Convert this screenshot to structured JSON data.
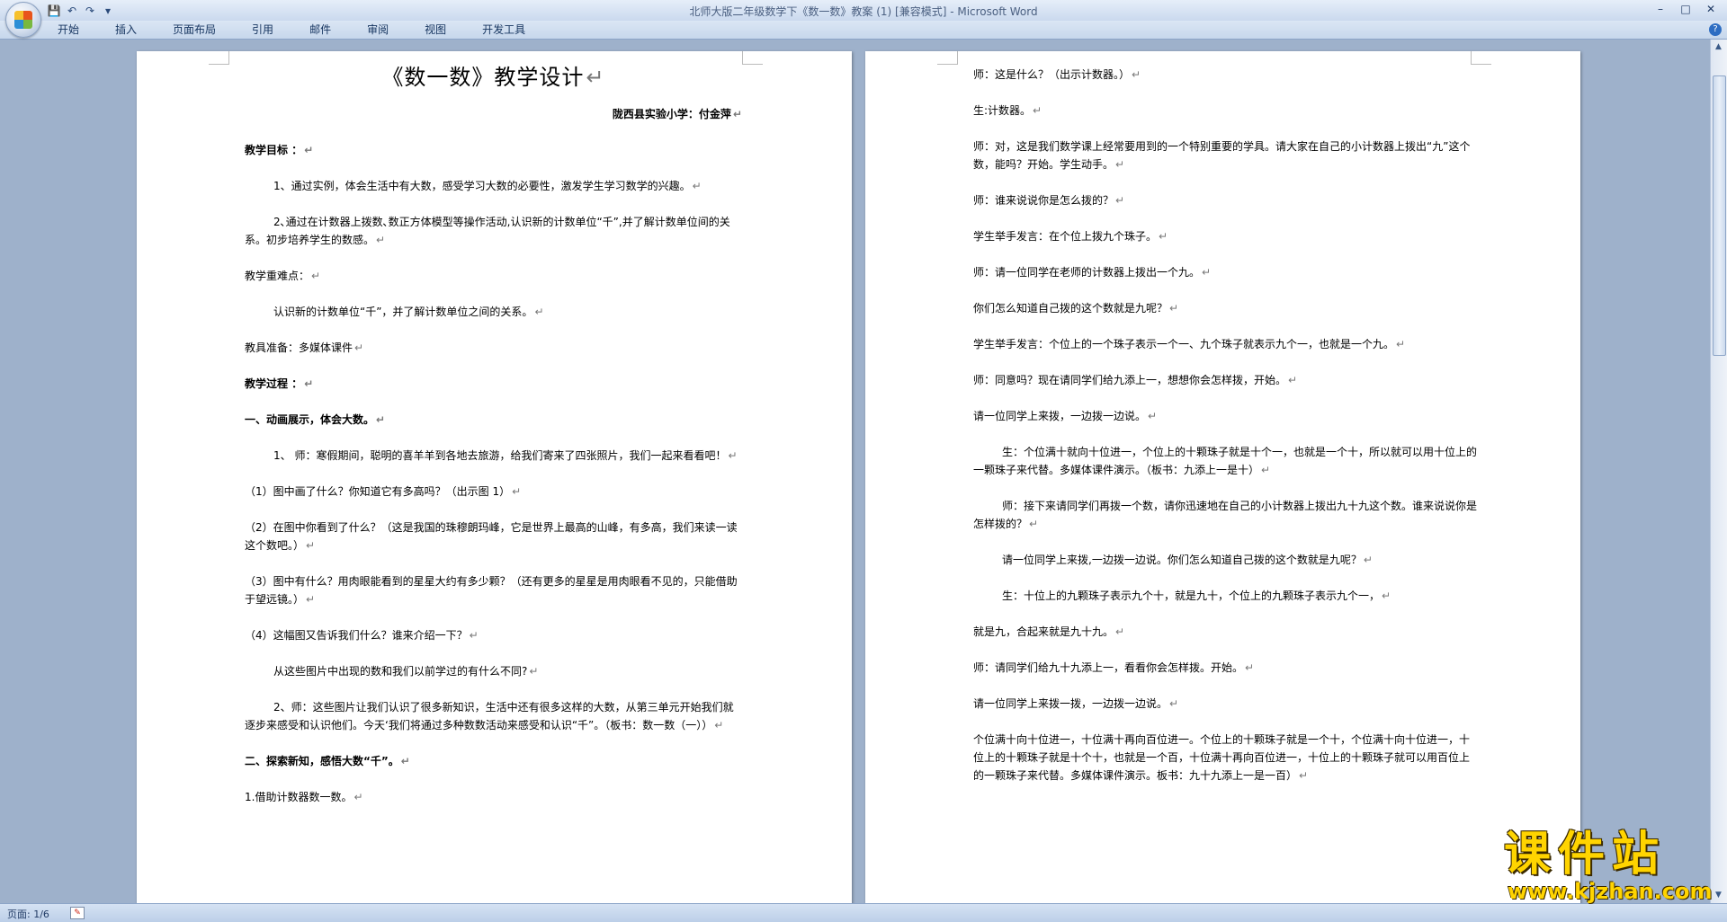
{
  "window": {
    "title": "北师大版二年级数学下《数一数》教案 (1) [兼容模式] - Microsoft Word",
    "min": "–",
    "max": "□",
    "close": "✕"
  },
  "quick_access": {
    "save_icon": "save-icon",
    "undo": "↶",
    "redo": "↷",
    "customize": "▾"
  },
  "ribbon": {
    "tabs": [
      "开始",
      "插入",
      "页面布局",
      "引用",
      "邮件",
      "审阅",
      "视图",
      "开发工具"
    ],
    "help": "?"
  },
  "left_page": {
    "title": "《数一数》教学设计",
    "author": "陇西县实验小学：付金萍",
    "paragraphs": [
      "教学目标 ：",
      "1、通过实例，体会生活中有大数，感受学习大数的必要性，激发学生学习数学的兴趣。",
      "2､通过在计数器上拨数､数正方体模型等操作活动,认识新的计数单位“千”,并了解计数单位间的关系。初步培养学生的数感。",
      "教学重难点：",
      "认识新的计数单位“千”，并了解计数单位之间的关系。",
      "教具准备：多媒体课件",
      "教学过程 ：",
      "一、动画展示，体会大数。",
      "1、 师：寒假期间，聪明的喜羊羊到各地去旅游，给我们寄来了四张照片，我们一起来看看吧！",
      "（1）图中画了什么？你知道它有多高吗？（出示图 1）",
      "（2）在图中你看到了什么？（这是我国的珠穆朗玛峰，它是世界上最高的山峰，有多高，我们来读一读这个数吧。）",
      "（3）图中有什么？用肉眼能看到的星星大约有多少颗？（还有更多的星星是用肉眼看不见的，只能借助于望远镜。）",
      "（4）这幅图又告诉我们什么？谁来介绍一下？",
      "从这些图片中出现的数和我们以前学过的有什么不同?",
      "2、师：这些图片让我们认识了很多新知识，生活中还有很多这样的大数，从第三单元开始我们就逐步来感受和认识他们。今天‘我们将通过多种数数活动来感受和认识“千”。（板书：数一数（一））",
      "二、探索新知，感悟大数“千”。",
      "1.借助计数器数一数。"
    ]
  },
  "right_page": {
    "paragraphs": [
      "师：这是什么？（出示计数器。）",
      "生:计数器。",
      "师：对，这是我们数学课上经常要用到的一个特别重要的学具。请大家在自己的小计数器上拨出“九”这个数，能吗？开始。学生动手。",
      "师：谁来说说你是怎么拨的？",
      "学生举手发言：在个位上拨九个珠子。",
      "师：请一位同学在老师的计数器上拨出一个九。",
      "你们怎么知道自己拨的这个数就是九呢？",
      "学生举手发言：个位上的一个珠子表示一个一、九个珠子就表示九个一，也就是一个九。",
      "师：同意吗？现在请同学们给九添上一，想想你会怎样拨，开始。",
      "请一位同学上来拨，一边拨一边说。",
      "生：个位满十就向十位进一，个位上的十颗珠子就是十个一，也就是一个十，所以就可以用十位上的一颗珠子来代替。多媒体课件演示。（板书：九添上一是十）",
      "师：接下来请同学们再拨一个数，请你迅速地在自己的小计数器上拨出九十九这个数。谁来说说你是怎样拨的？",
      "请一位同学上来拨,一边拨一边说。你们怎么知道自己拨的这个数就是九呢？",
      "生：十位上的九颗珠子表示九个十，就是九十，个位上的九颗珠子表示九个一，",
      "就是九，合起来就是九十九。",
      "师：请同学们给九十九添上一，看看你会怎样拨。开始。",
      "请一位同学上来拨一拨，一边拨一边说。",
      "个位满十向十位进一，十位满十再向百位进一。个位上的十颗珠子就是一个十，个位满十向十位进一，十位上的十颗珠子就是十个十，也就是一个百，十位满十再向百位进一，十位上的十颗珠子就可以用百位上的一颗珠子来代替。多媒体课件演示。板书：九十九添上一是一百）"
    ]
  },
  "status": {
    "page": "页面: 1/6"
  },
  "watermark": {
    "title": "课件站",
    "url": "www.kjzhan.com"
  }
}
